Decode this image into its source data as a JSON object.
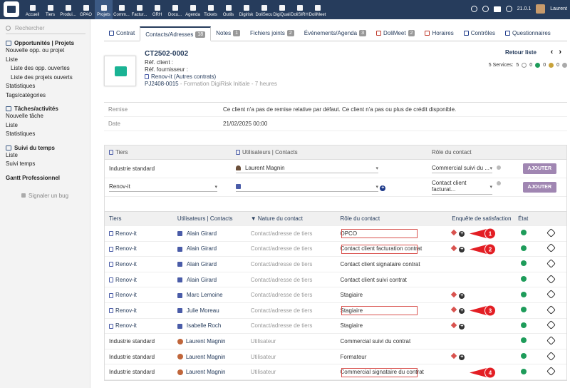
{
  "topbar": {
    "menu": [
      "Accueil",
      "Tiers",
      "Produi...",
      "GPAO",
      "Projets",
      "Comm...",
      "Factur...",
      "GRH",
      "Docu...",
      "Agenda",
      "Tickets",
      "Outils",
      "Digirisk",
      "DoliSecu",
      "DigiQuali",
      "DoliSIRH",
      "DoliMeet"
    ],
    "version": "21.0.1",
    "user": "Laurent"
  },
  "left": {
    "search_placeholder": "Rechercher",
    "sec1": "Opportunités | Projets",
    "sec1_items": [
      "Nouvelle opp. ou projet",
      "Liste"
    ],
    "sec1_sub": [
      "Liste des opp. ouvertes",
      "Liste des projets ouverts"
    ],
    "sec1_more": [
      "Statistiques",
      "Tags/catégories"
    ],
    "sec2": "Tâches/activités",
    "sec2_items": [
      "Nouvelle tâche",
      "Liste",
      "Statistiques"
    ],
    "sec3": "Suivi du temps",
    "sec3_items": [
      "Liste",
      "Suivi temps"
    ],
    "sec4": "Gantt Professionnel",
    "bug": "Signaler un bug"
  },
  "tabs": [
    {
      "label": "Contrat",
      "badge": ""
    },
    {
      "label": "Contacts/Adresses",
      "badge": "18"
    },
    {
      "label": "Notes",
      "badge": "1"
    },
    {
      "label": "Fichiers joints",
      "badge": "2"
    },
    {
      "label": "Événements/Agenda",
      "badge": "3"
    },
    {
      "label": "DoliMeet",
      "badge": "2"
    },
    {
      "label": "Horaires",
      "badge": ""
    },
    {
      "label": "Contrôles",
      "badge": ""
    },
    {
      "label": "Questionnaires",
      "badge": ""
    }
  ],
  "contract": {
    "ref": "CT2502-0002",
    "ref_client": "Réf. client :",
    "ref_fournisseur": "Réf. fournisseur :",
    "tiers": "Renov-it",
    "tiers_extra": "(Autres contrats)",
    "project": "PJ2408-0015",
    "project_label": "- Formation DigiRisk Initiale - 7 heures",
    "retour": "Retour liste",
    "services_label": "5 Services:",
    "services": [
      "5",
      "0",
      "0",
      "0"
    ]
  },
  "info": {
    "remise_k": "Remise",
    "remise_v": "Ce client n'a pas de remise relative par défaut. Ce client n'a pas ou plus de crédit disponible.",
    "date_k": "Date",
    "date_v": "21/02/2025 00:00"
  },
  "add": {
    "h1": "Tiers",
    "h2": "Utilisateurs | Contacts",
    "h3": "Rôle du contact",
    "r1_tiers": "Industrie standard",
    "r1_user": "Laurent Magnin",
    "r1_role": "Commercial suivi du ...",
    "r2_tiers": "Renov-it",
    "r2_role": "Contact client facturat...",
    "btn": "AJOUTER"
  },
  "table": {
    "headers": [
      "Tiers",
      "Utilisateurs | Contacts",
      "Nature du contact",
      "Rôle du contact",
      "Enquête de satisfaction",
      "État"
    ],
    "rows": [
      {
        "tiers": "Renov-it",
        "contact": "Alain Girard",
        "nature": "Contact/adresse de tiers",
        "role": "OPCO"
      },
      {
        "tiers": "Renov-it",
        "contact": "Alain Girard",
        "nature": "Contact/adresse de tiers",
        "role": "Contact client facturation contrat"
      },
      {
        "tiers": "Renov-it",
        "contact": "Alain Girard",
        "nature": "Contact/adresse de tiers",
        "role": "Contact client signataire contrat"
      },
      {
        "tiers": "Renov-it",
        "contact": "Alain Girard",
        "nature": "Contact/adresse de tiers",
        "role": "Contact client suivi contrat"
      },
      {
        "tiers": "Renov-it",
        "contact": "Marc Lemoine",
        "nature": "Contact/adresse de tiers",
        "role": "Stagiaire"
      },
      {
        "tiers": "Renov-it",
        "contact": "Julie Moreau",
        "nature": "Contact/adresse de tiers",
        "role": "Stagiaire"
      },
      {
        "tiers": "Renov-it",
        "contact": "Isabelle Roch",
        "nature": "Contact/adresse de tiers",
        "role": "Stagiaire"
      },
      {
        "tiers": "Industrie standard",
        "contact": "Laurent Magnin",
        "nature": "Utilisateur",
        "role": "Commercial suivi du contrat"
      },
      {
        "tiers": "Industrie standard",
        "contact": "Laurent Magnin",
        "nature": "Utilisateur",
        "role": "Formateur"
      },
      {
        "tiers": "Industrie standard",
        "contact": "Laurent Magnin",
        "nature": "Utilisateur",
        "role": "Commercial signataire du contrat"
      }
    ],
    "markers": [
      "1",
      "2",
      "3",
      "4"
    ]
  }
}
